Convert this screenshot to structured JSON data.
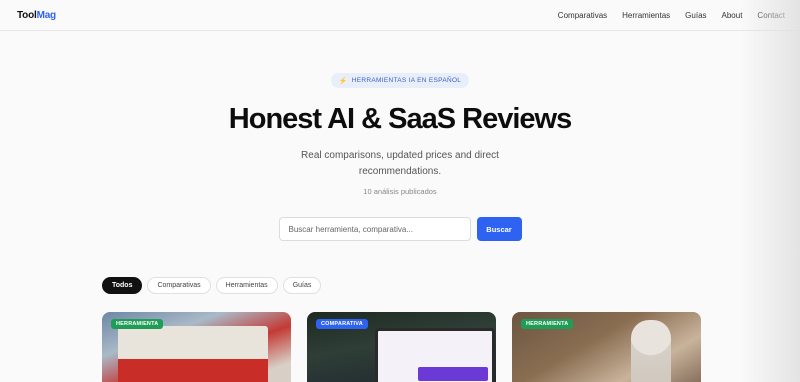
{
  "brand": {
    "part1": "Tool",
    "part2": "Mag"
  },
  "nav": [
    "Comparativas",
    "Herramientas",
    "Guías",
    "About",
    "Contact"
  ],
  "hero": {
    "badge": "HERRAMIENTAS IA EN ESPAÑOL",
    "badge_icon": "bolt-icon",
    "title": "Honest AI & SaaS Reviews",
    "subtitle": "Real comparisons, updated prices and direct recommendations.",
    "count": "10 análisis publicados"
  },
  "search": {
    "placeholder": "Buscar herramienta, comparativa...",
    "button": "Buscar"
  },
  "filters": [
    {
      "label": "Todos",
      "active": true
    },
    {
      "label": "Comparativas",
      "active": false
    },
    {
      "label": "Herramientas",
      "active": false
    },
    {
      "label": "Guías",
      "active": false
    }
  ],
  "cards": [
    {
      "tag": "HERRAMIENTA",
      "tag_color": "#1f9d57"
    },
    {
      "tag": "COMPARATIVA",
      "tag_color": "#2d63f0"
    },
    {
      "tag": "HERRAMIENTA",
      "tag_color": "#1f9d57"
    }
  ],
  "colors": {
    "accent": "#2d63f0",
    "green": "#1f9d57"
  }
}
